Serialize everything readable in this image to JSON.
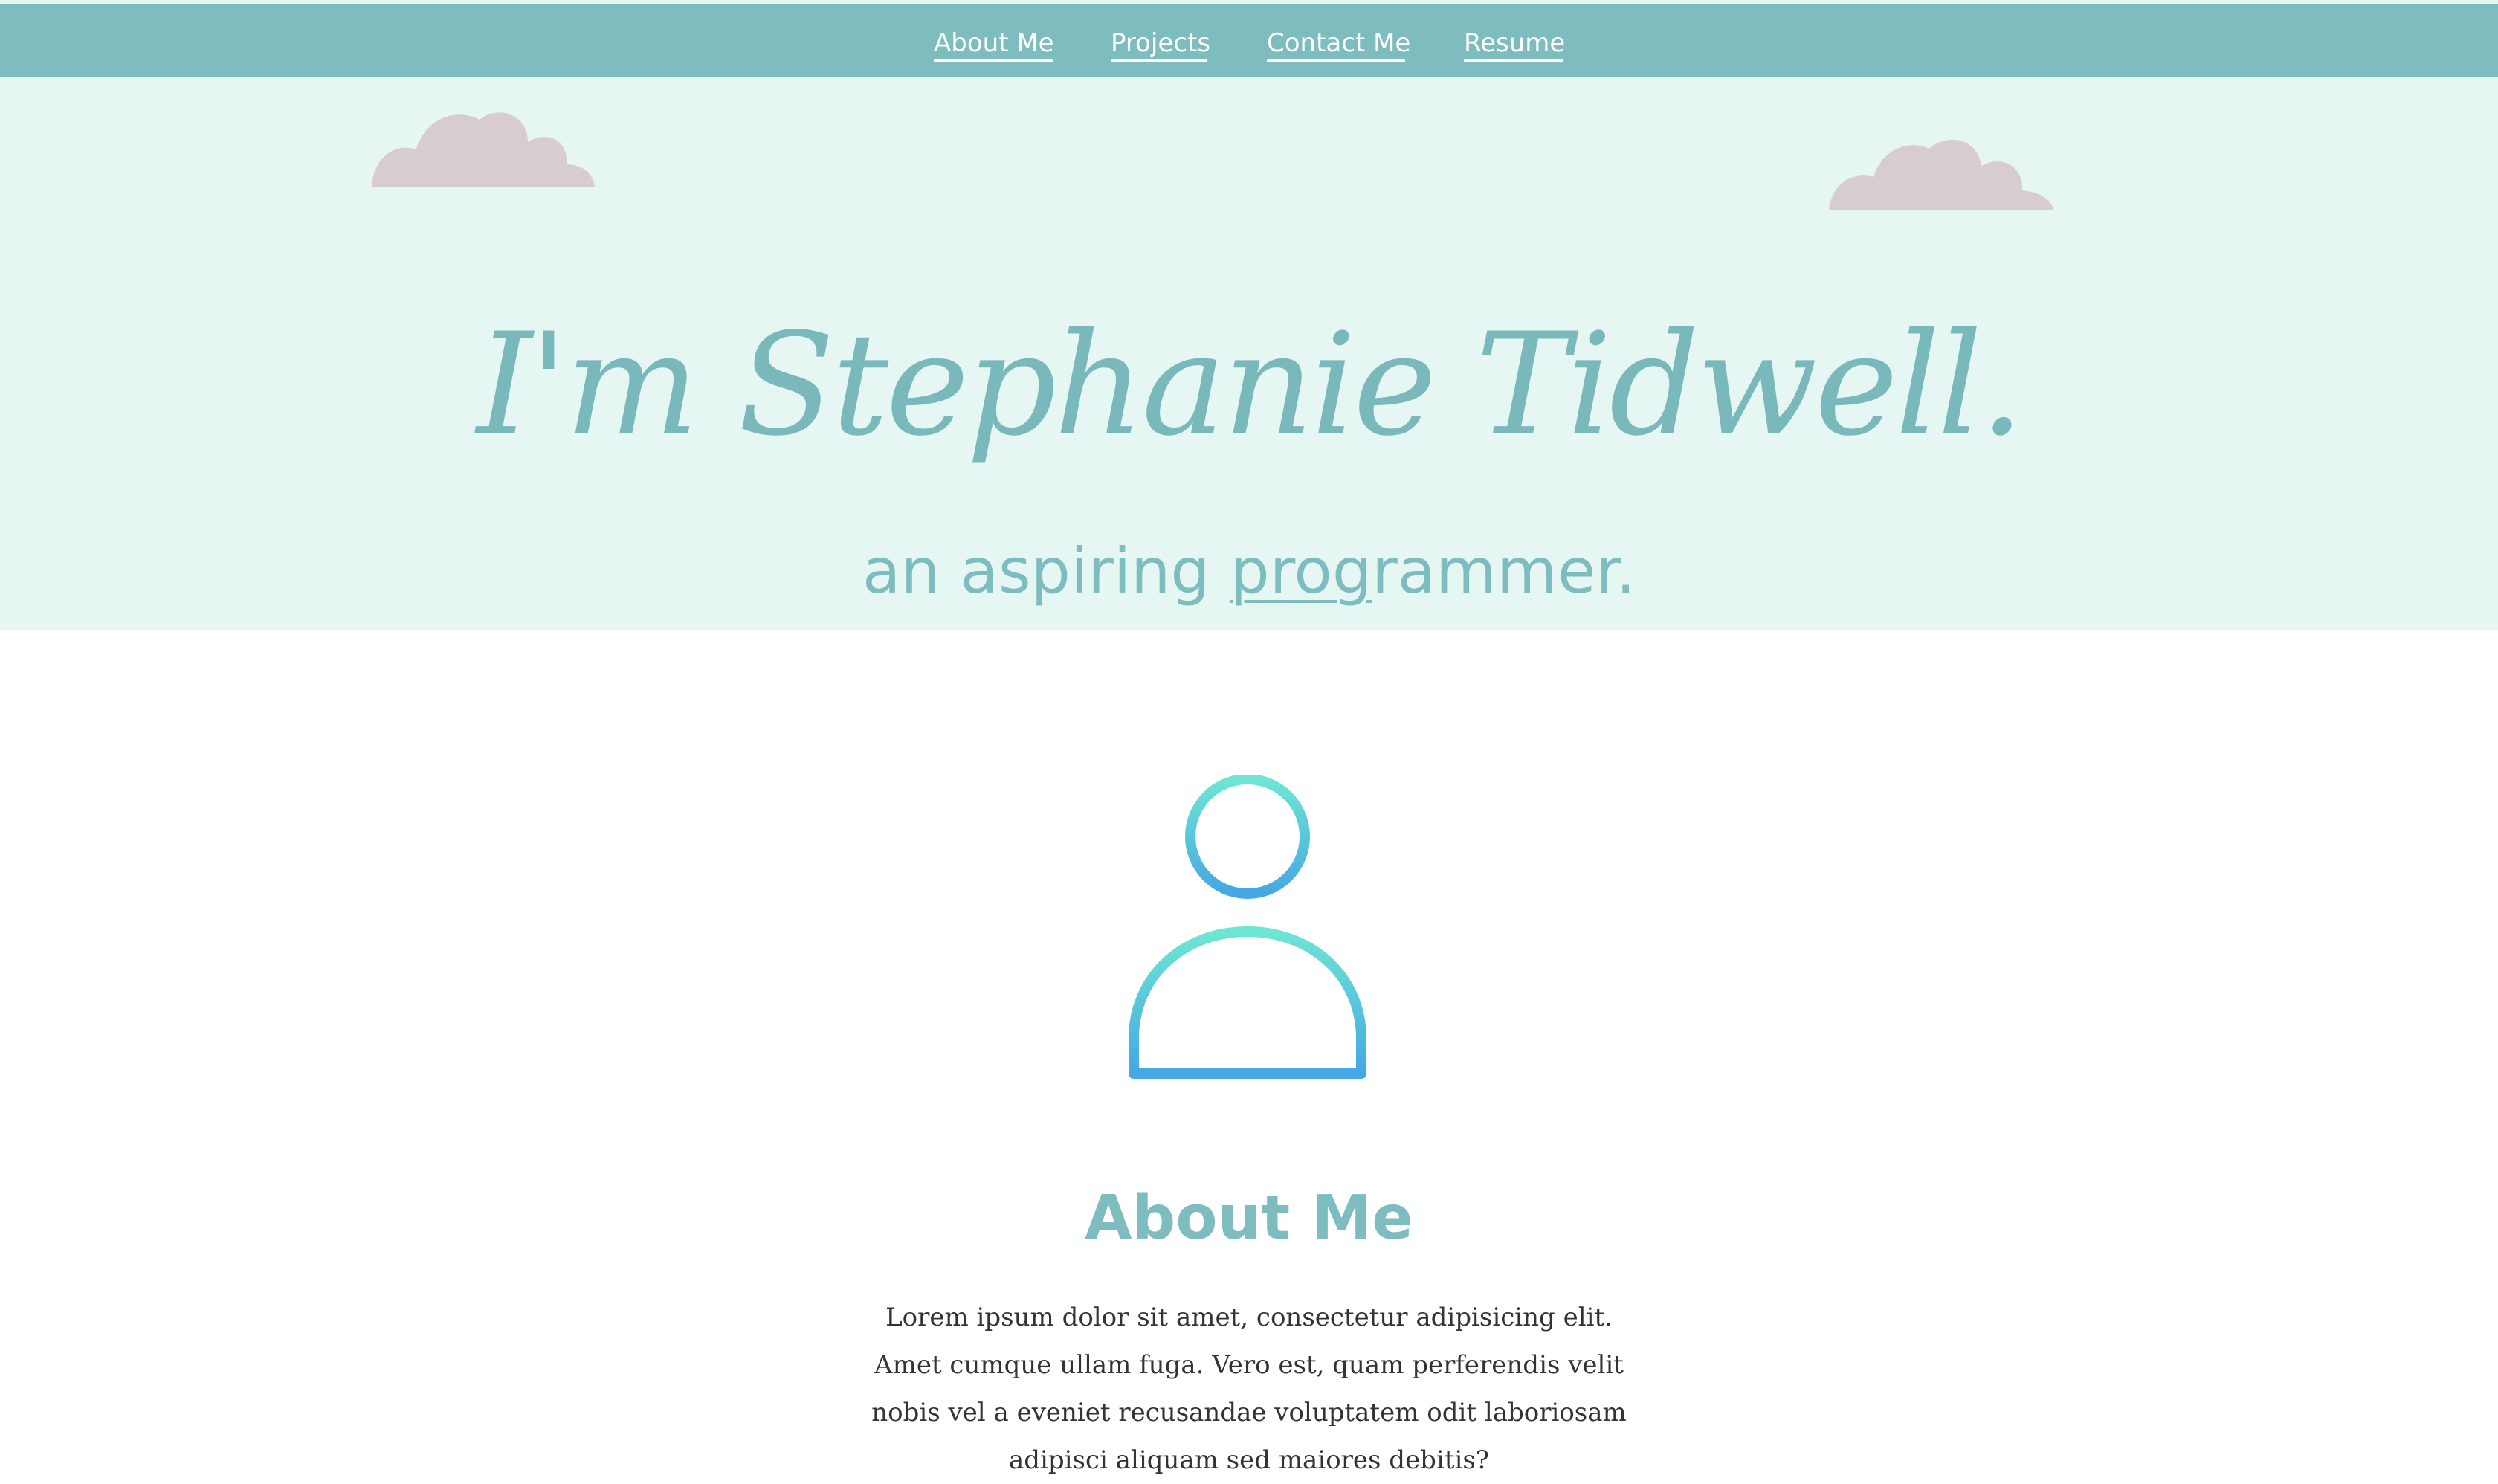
{
  "nav": {
    "links": [
      {
        "label": "About Me"
      },
      {
        "label": "Projects"
      },
      {
        "label": "Contact Me"
      },
      {
        "label": "Resume"
      }
    ]
  },
  "hero": {
    "title": "I'm Stephanie Tidwell.",
    "subtitle_prefix": "an aspiring ",
    "subtitle_underlined": "prog",
    "subtitle_suffix": "rammer."
  },
  "about": {
    "icon": "person-icon",
    "heading": "About Me",
    "body": "Lorem ipsum dolor sit amet, consectetur adipisicing elit. Amet cumque ullam fuga. Vero est, quam perferendis velit nobis vel a eveniet recusandae voluptatem odit laboriosam adipisci aliquam sed maiores debitis?"
  },
  "colors": {
    "nav_bg": "#7dbdbf",
    "hero_bg": "#e6f6f3",
    "accent": "#7dbdbf",
    "cloud": "#d8ccd3",
    "icon_gradient_top": "#6ee6d4",
    "icon_gradient_bottom": "#45a8e2"
  }
}
